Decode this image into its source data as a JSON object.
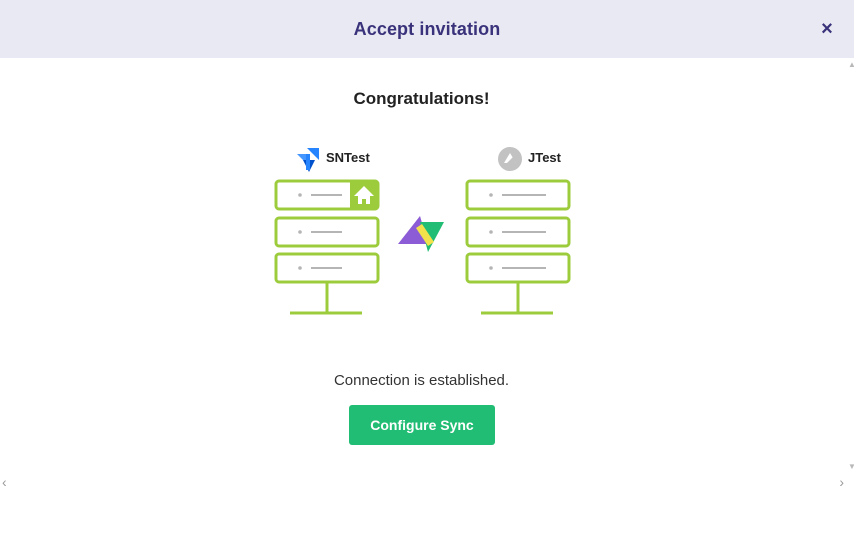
{
  "dialog": {
    "title": "Accept invitation",
    "close_label": "×"
  },
  "main": {
    "heading": "Congratulations!",
    "status": "Connection is established.",
    "configure_button": "Configure Sync"
  },
  "nodes": {
    "left": {
      "name": "SNTest",
      "icon": "jira-icon"
    },
    "right": {
      "name": "JTest",
      "icon": "node-logo-icon"
    }
  },
  "colors": {
    "header_bg": "#e8e9f3",
    "title": "#3a327a",
    "server_green": "#9ccc3c",
    "button_green": "#22bd74"
  },
  "nav": {
    "prev": "‹",
    "next": "›"
  }
}
